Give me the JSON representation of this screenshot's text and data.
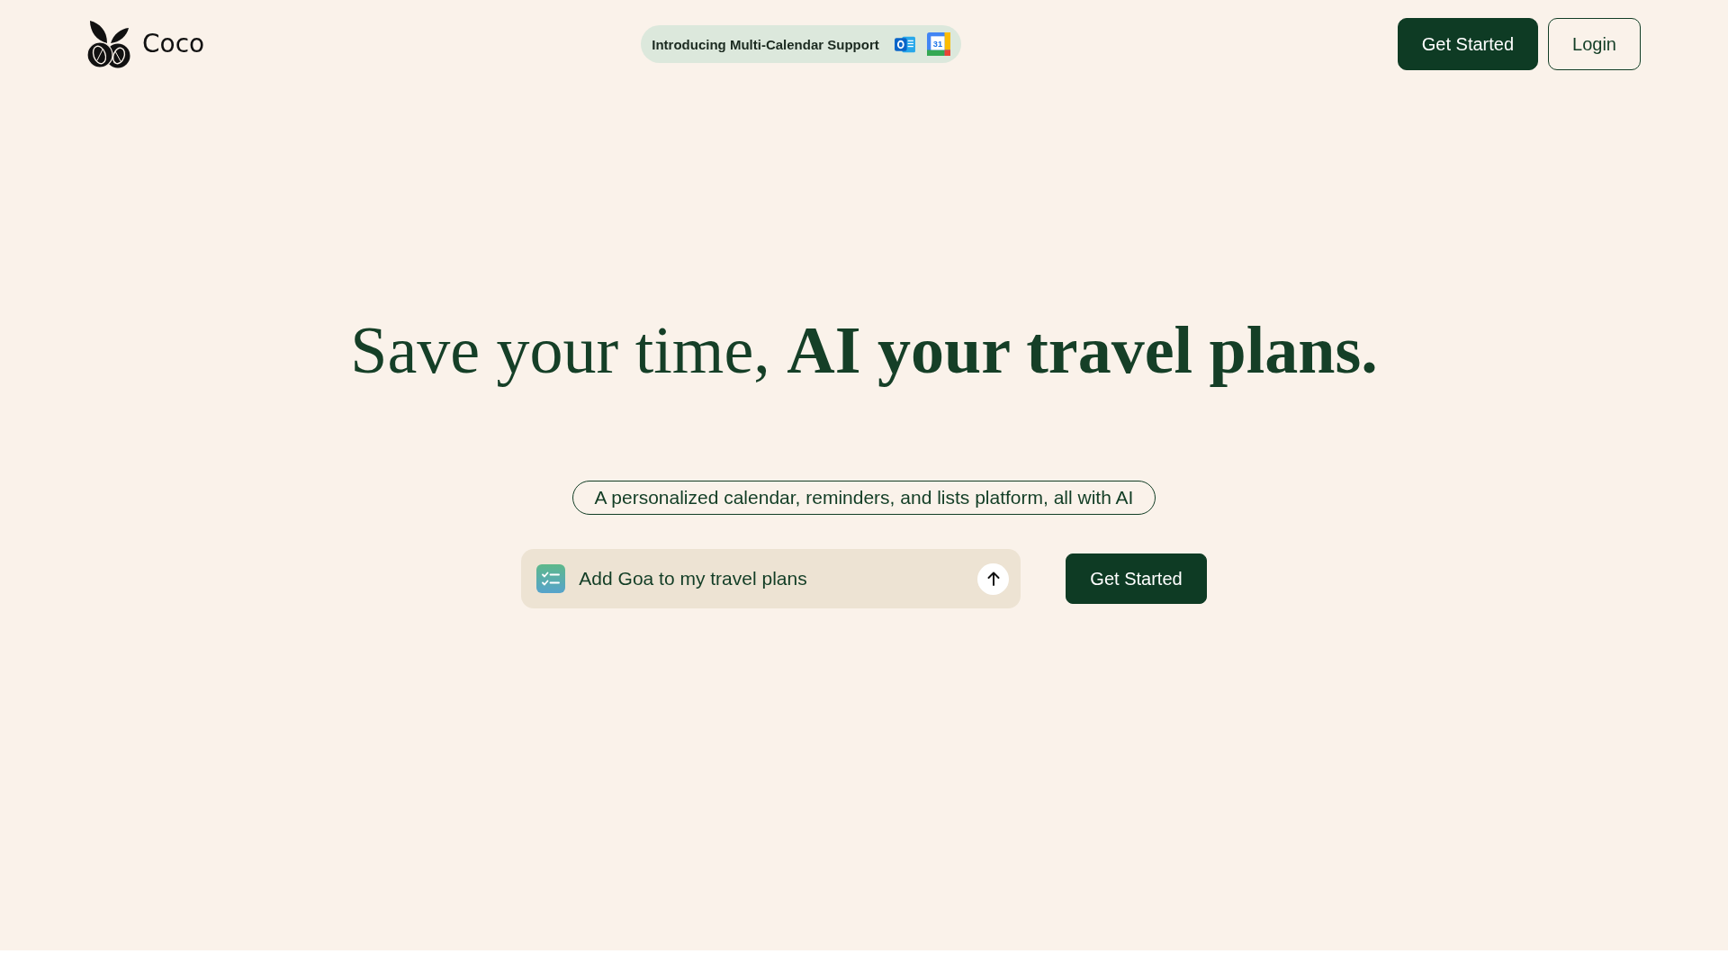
{
  "header": {
    "logo": {
      "text": "Coco"
    },
    "announcement": {
      "text": "Introducing Multi-Calendar Support",
      "calendar_icon_label": "31"
    },
    "buttons": [
      {
        "label": "Get Started",
        "kind": "primary"
      },
      {
        "label": "Login",
        "kind": "outline"
      }
    ]
  },
  "hero": {
    "headline": "Save your time, **AI your travel plans.**",
    "tagline": "A personalized calendar, reminders, and lists platform, all with AI",
    "prompt": {
      "value": "Add Goa to my travel plans"
    },
    "button": {
      "label": "Get Started",
      "kind": "primary"
    }
  }
}
